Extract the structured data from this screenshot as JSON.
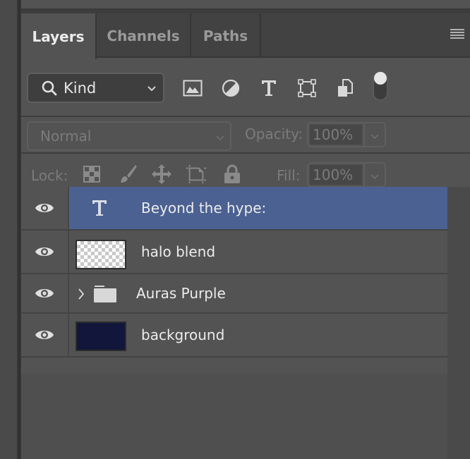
{
  "tabs": [
    {
      "label": "Layers",
      "active": true
    },
    {
      "label": "Channels",
      "active": false
    },
    {
      "label": "Paths",
      "active": false
    }
  ],
  "panel_menu_icon": "hamburger-menu-icon",
  "filter": {
    "kind_label": "Kind",
    "icons": [
      "pixel-layer-filter-icon",
      "adjustment-layer-filter-icon",
      "type-layer-filter-icon",
      "shape-layer-filter-icon",
      "smart-object-filter-icon"
    ],
    "toggle_on": true
  },
  "blend": {
    "mode": "Normal",
    "opacity_label": "Opacity:",
    "opacity_value": "100%"
  },
  "lock": {
    "label": "Lock:",
    "icons": [
      "lock-transparent-pixels-icon",
      "lock-image-pixels-icon",
      "lock-position-icon",
      "lock-artboard-icon",
      "lock-all-icon"
    ],
    "fill_label": "Fill:",
    "fill_value": "100%"
  },
  "layers": [
    {
      "name": "Beyond the hype:",
      "type": "text",
      "visible": true,
      "selected": true
    },
    {
      "name": "halo blend",
      "type": "pixel",
      "thumb": "transparent",
      "visible": true,
      "selected": false
    },
    {
      "name": "Auras Purple",
      "type": "group",
      "visible": true,
      "selected": false,
      "expanded": false
    },
    {
      "name": "background",
      "type": "pixel",
      "thumb_color": "#12163a",
      "visible": true,
      "selected": false
    }
  ],
  "colors": {
    "selection": "#4b6192",
    "panel_bg": "#535353",
    "tab_bar_bg": "#424242"
  }
}
